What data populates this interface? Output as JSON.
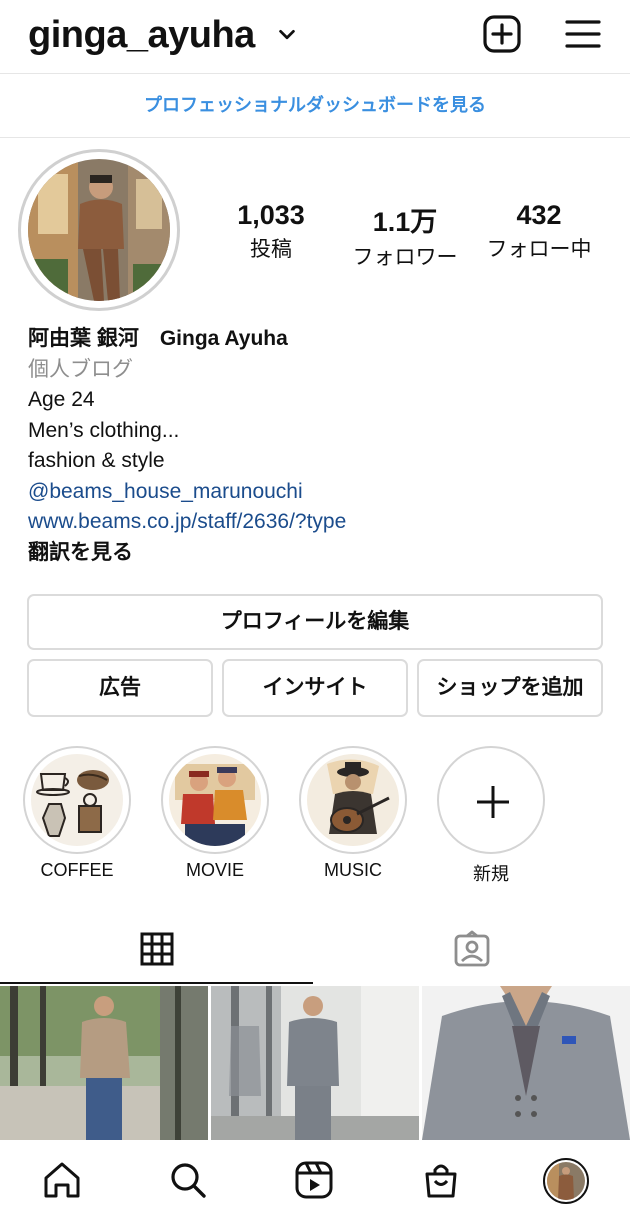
{
  "header": {
    "username": "ginga_ayuha"
  },
  "dashboard_link": "プロフェッショナルダッシュボードを見る",
  "stats": [
    {
      "value": "1,033",
      "label": "投稿"
    },
    {
      "value": "1.1万",
      "label": "フォロワー"
    },
    {
      "value": "432",
      "label": "フォロー中"
    }
  ],
  "bio": {
    "name": "阿由葉 銀河　Ginga Ayuha",
    "category": "個人ブログ",
    "lines": [
      "Age 24",
      "Men’s clothing...",
      "fashion & style"
    ],
    "mention": "@beams_house_marunouchi",
    "url": "www.beams.co.jp/staff/2636/?type",
    "translate": "翻訳を見る"
  },
  "buttons": {
    "edit_profile": "プロフィールを編集",
    "ads": "広告",
    "insights": "インサイト",
    "add_shop": "ショップを追加"
  },
  "highlights": [
    {
      "label": "COFFEE"
    },
    {
      "label": "MOVIE"
    },
    {
      "label": "MUSIC"
    },
    {
      "label": "新規"
    }
  ],
  "colors": {
    "link_blue": "#3a8fe0",
    "bio_link": "#1b4c8c",
    "border": "#dbdbdb",
    "muted": "#8e8e8e"
  }
}
